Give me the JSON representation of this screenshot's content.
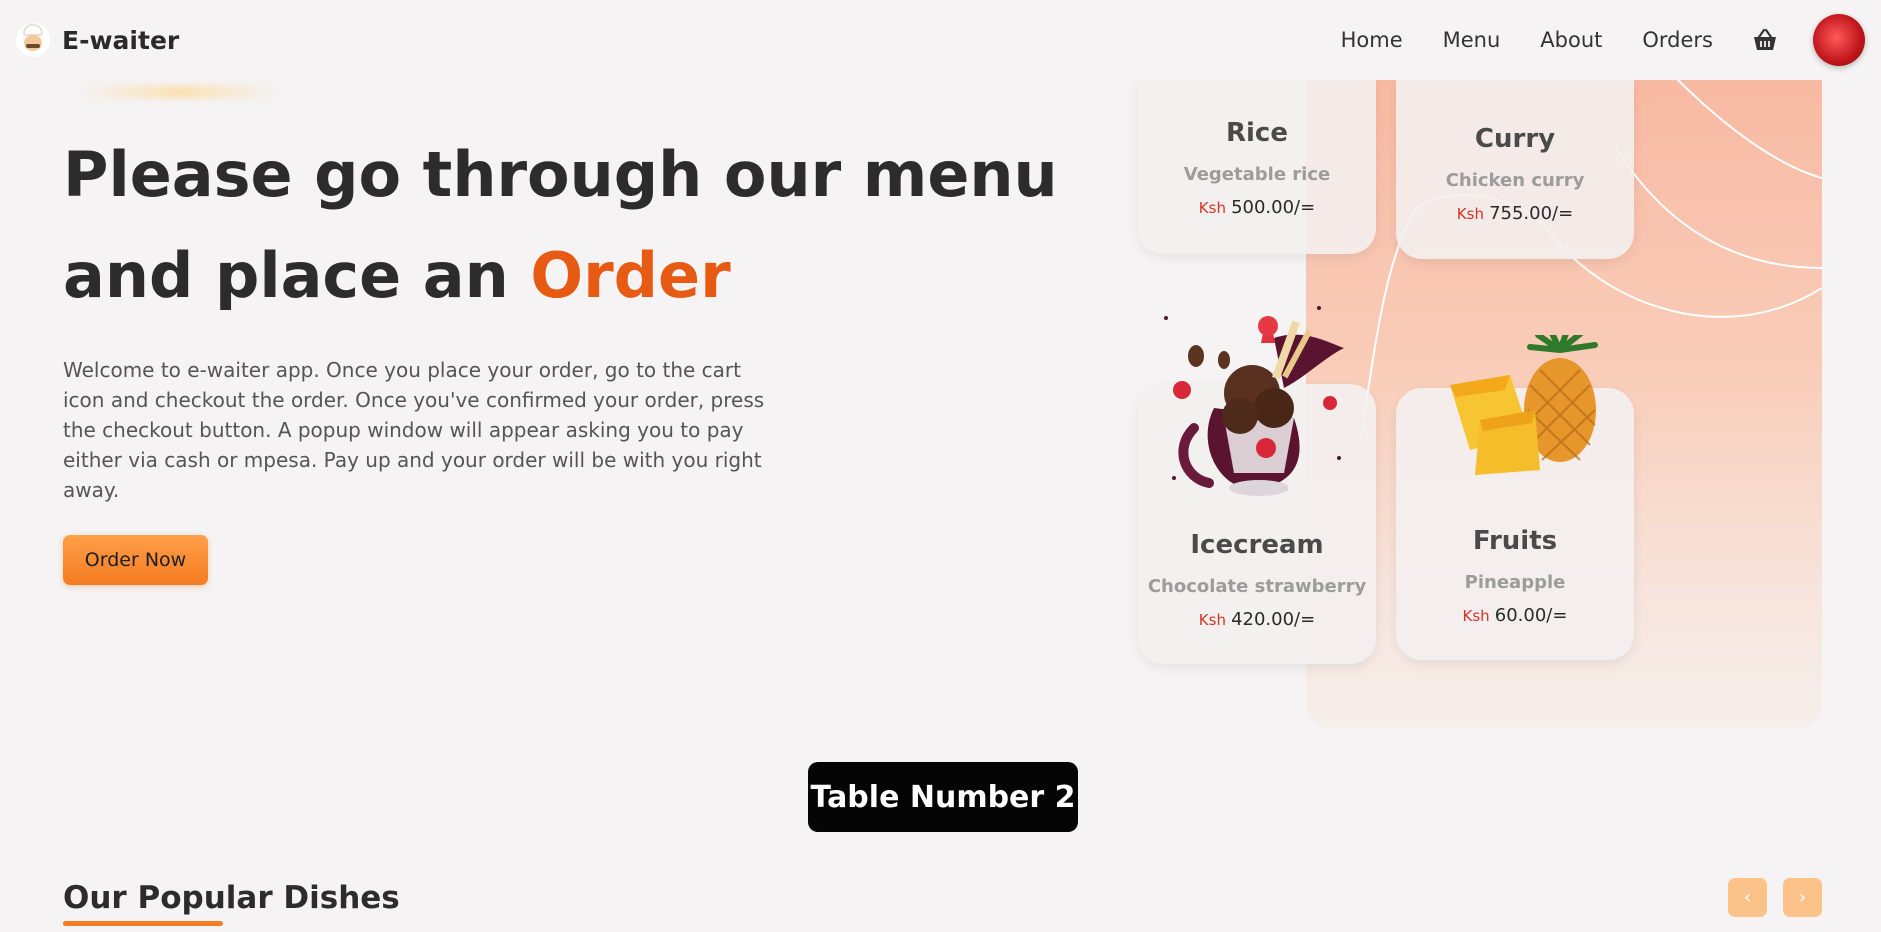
{
  "header": {
    "brand": "E-waiter",
    "nav": [
      "Home",
      "Menu",
      "About",
      "Orders"
    ]
  },
  "hero": {
    "title_lead": "Please go through our menu and place an ",
    "title_accent": "Order",
    "description": "Welcome to e-waiter app. Once you place your order, go to the cart icon and checkout the order. Once you've confirmed your order, press the checkout button. A popup window will appear asking you to pay either via cash or mpesa. Pay up and your order will be with you right away.",
    "cta": "Order Now"
  },
  "menu_cards": [
    {
      "title": "Rice",
      "subtitle": "Vegetable rice",
      "currency": "Ksh",
      "price": "500.00/="
    },
    {
      "title": "Curry",
      "subtitle": "Chicken curry",
      "currency": "Ksh",
      "price": "755.00/="
    },
    {
      "title": "Icecream",
      "subtitle": "Chocolate strawberry",
      "currency": "Ksh",
      "price": "420.00/="
    },
    {
      "title": "Fruits",
      "subtitle": "Pineapple",
      "currency": "Ksh",
      "price": "60.00/="
    }
  ],
  "table_badge": "Table Number 2",
  "popular": {
    "title": "Our Popular Dishes",
    "prev": "‹",
    "next": "›"
  },
  "colors": {
    "accent": "#e65a14",
    "button": "#f47b20",
    "arrow_buttons": "#fbc38a",
    "price_currency": "#d63326"
  },
  "icons": [
    "chef-logo-icon",
    "basket-icon",
    "user-avatar",
    "icecream-image",
    "pineapple-image",
    "chevron-left-icon",
    "chevron-right-icon"
  ]
}
